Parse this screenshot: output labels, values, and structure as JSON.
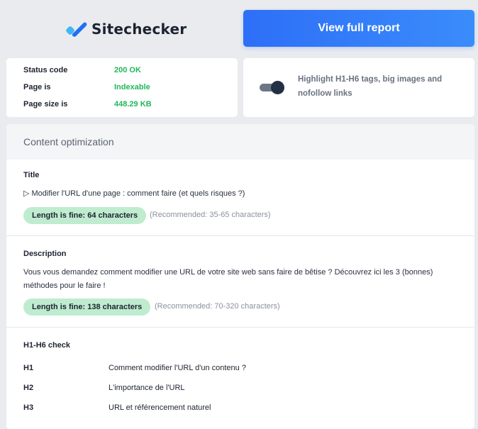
{
  "header": {
    "brand": "Sitechecker",
    "report_button": "View full report"
  },
  "status": {
    "rows": [
      {
        "label": "Status code",
        "value": "200 OK"
      },
      {
        "label": "Page is",
        "value": "Indexable"
      },
      {
        "label": "Page size is",
        "value": "448.29 KB"
      }
    ]
  },
  "highlight": {
    "toggle_on": true,
    "label": "Highlight H1-H6 tags, big images and nofollow links"
  },
  "content": {
    "heading": "Content optimization",
    "title": {
      "label": "Title",
      "text": "▷ Modifier l'URL d'une page : comment faire (et quels risques ?)",
      "badge": "Length is fine: 64 characters",
      "recommended": "(Recommended: 35-65 characters)"
    },
    "description": {
      "label": "Description",
      "text": "Vous vous demandez comment modifier une URL de votre site web sans faire de bêtise ? Découvrez ici les 3 (bonnes) méthodes pour le faire !",
      "badge": "Length is fine: 138 characters",
      "recommended": "(Recommended: 70-320 characters)"
    },
    "headings_check": {
      "label": "H1-H6 check",
      "rows": [
        {
          "tag": "H1",
          "text": "Comment modifier l'URL d'un contenu ?"
        },
        {
          "tag": "H2",
          "text": "L'importance de l'URL"
        },
        {
          "tag": "H3",
          "text": "URL et référencement naturel"
        }
      ]
    }
  },
  "colors": {
    "accent": "#2d6ff7",
    "ok_green": "#1fb85a",
    "badge_bg": "#bfeccf"
  }
}
